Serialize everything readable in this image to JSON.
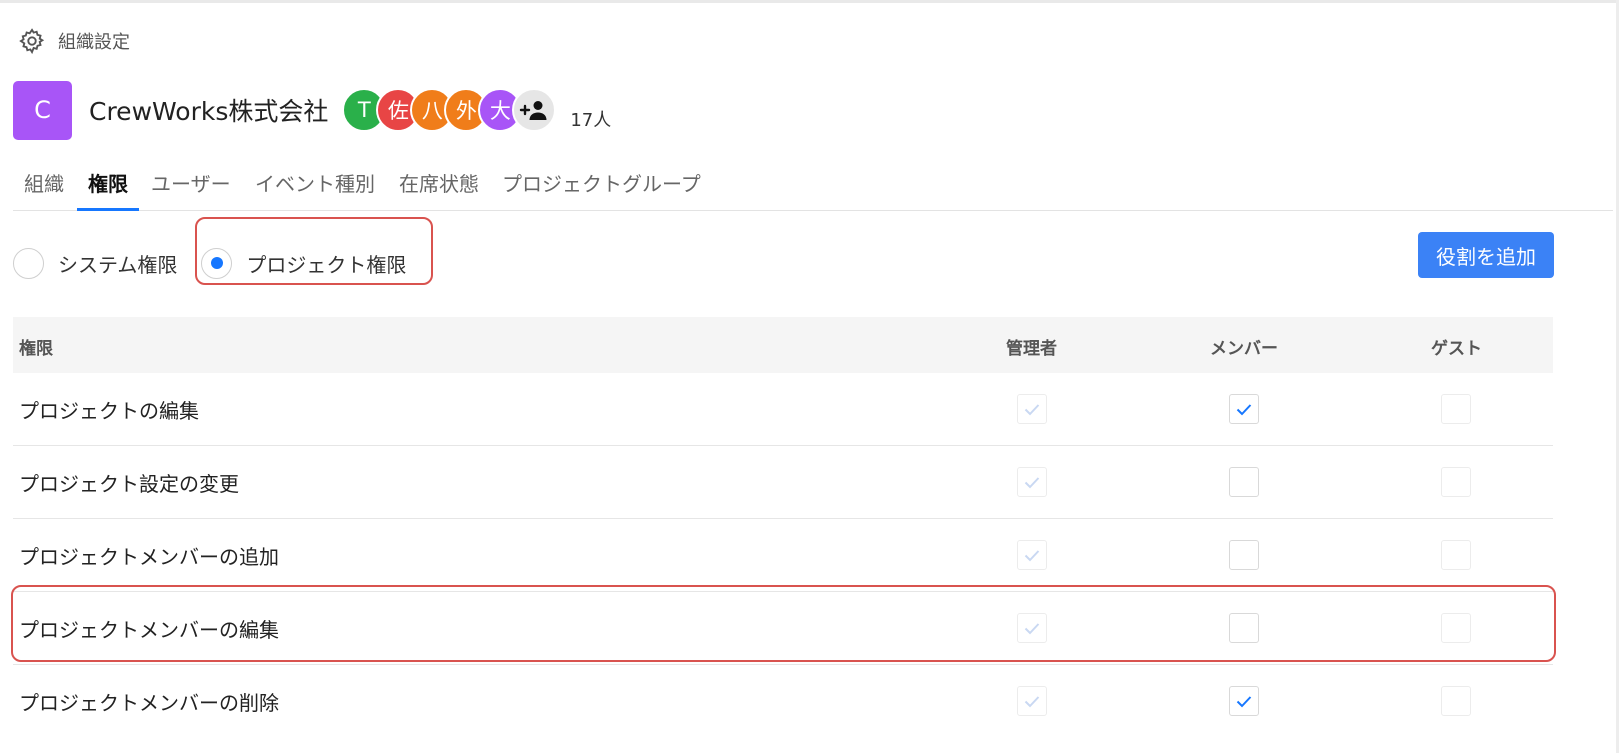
{
  "breadcrumb": {
    "icon": "gear-icon",
    "text": "組織設定"
  },
  "org": {
    "logo_letter": "C",
    "logo_color": "#a855f7",
    "name": "CrewWorks株式会社",
    "avatars": [
      {
        "label": "T",
        "color": "#2ab04a"
      },
      {
        "label": "佐",
        "color": "#e84545"
      },
      {
        "label": "八",
        "color": "#f07d1a"
      },
      {
        "label": "外",
        "color": "#f07d1a"
      },
      {
        "label": "大",
        "color": "#a855f7"
      }
    ],
    "add_user_icon": "add-user-icon",
    "member_count": "17人"
  },
  "tabs": [
    {
      "label": "組織",
      "active": false
    },
    {
      "label": "権限",
      "active": true
    },
    {
      "label": "ユーザー",
      "active": false
    },
    {
      "label": "イベント種別",
      "active": false
    },
    {
      "label": "在席状態",
      "active": false
    },
    {
      "label": "プロジェクトグループ",
      "active": false
    }
  ],
  "radio": {
    "options": [
      {
        "label": "システム権限",
        "selected": false
      },
      {
        "label": "プロジェクト権限",
        "selected": true
      }
    ]
  },
  "buttons": {
    "add_role": "役割を追加"
  },
  "table": {
    "headers": {
      "permission": "権限",
      "admin": "管理者",
      "member": "メンバー",
      "guest": "ゲスト"
    },
    "rows": [
      {
        "label": "プロジェクトの編集",
        "admin": true,
        "member": true,
        "guest": false
      },
      {
        "label": "プロジェクト設定の変更",
        "admin": true,
        "member": false,
        "guest": false
      },
      {
        "label": "プロジェクトメンバーの追加",
        "admin": true,
        "member": false,
        "guest": false
      },
      {
        "label": "プロジェクトメンバーの編集",
        "admin": true,
        "member": false,
        "guest": false
      },
      {
        "label": "プロジェクトメンバーの削除",
        "admin": true,
        "member": true,
        "guest": false
      }
    ]
  },
  "colors": {
    "accent": "#1677ff",
    "button": "#3b82f6",
    "highlight": "#d9534f"
  }
}
